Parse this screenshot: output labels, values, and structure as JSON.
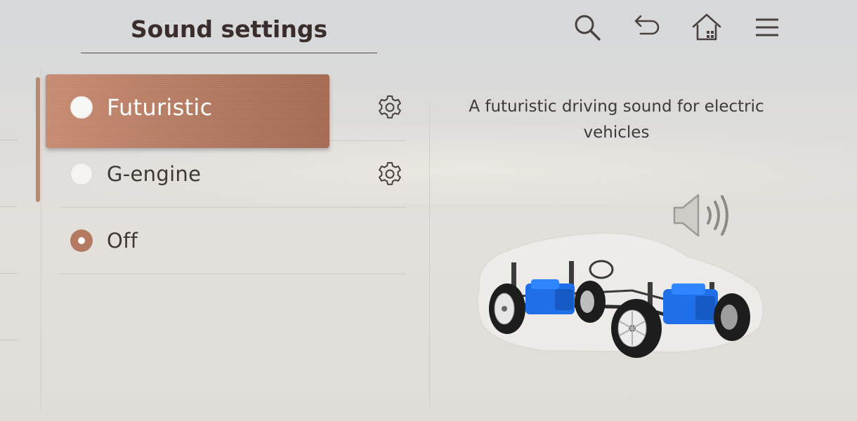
{
  "header": {
    "title": "Sound settings"
  },
  "toolbar": {
    "icons": [
      "search-icon",
      "back-icon",
      "home-icon",
      "menu-icon"
    ]
  },
  "sound_options": [
    {
      "label": "Futuristic",
      "selected": false,
      "highlighted": true,
      "has_settings": true
    },
    {
      "label": "G-engine",
      "selected": false,
      "highlighted": false,
      "has_settings": true
    },
    {
      "label": "Off",
      "selected": true,
      "highlighted": false,
      "has_settings": false
    }
  ],
  "detail": {
    "description": "A futuristic driving sound for electric vehicles"
  },
  "colors": {
    "accent": "#b47a62",
    "highlight_card": "#b77c63",
    "text_primary": "#3e3836",
    "ev_motor_blue": "#1e6fe8"
  }
}
